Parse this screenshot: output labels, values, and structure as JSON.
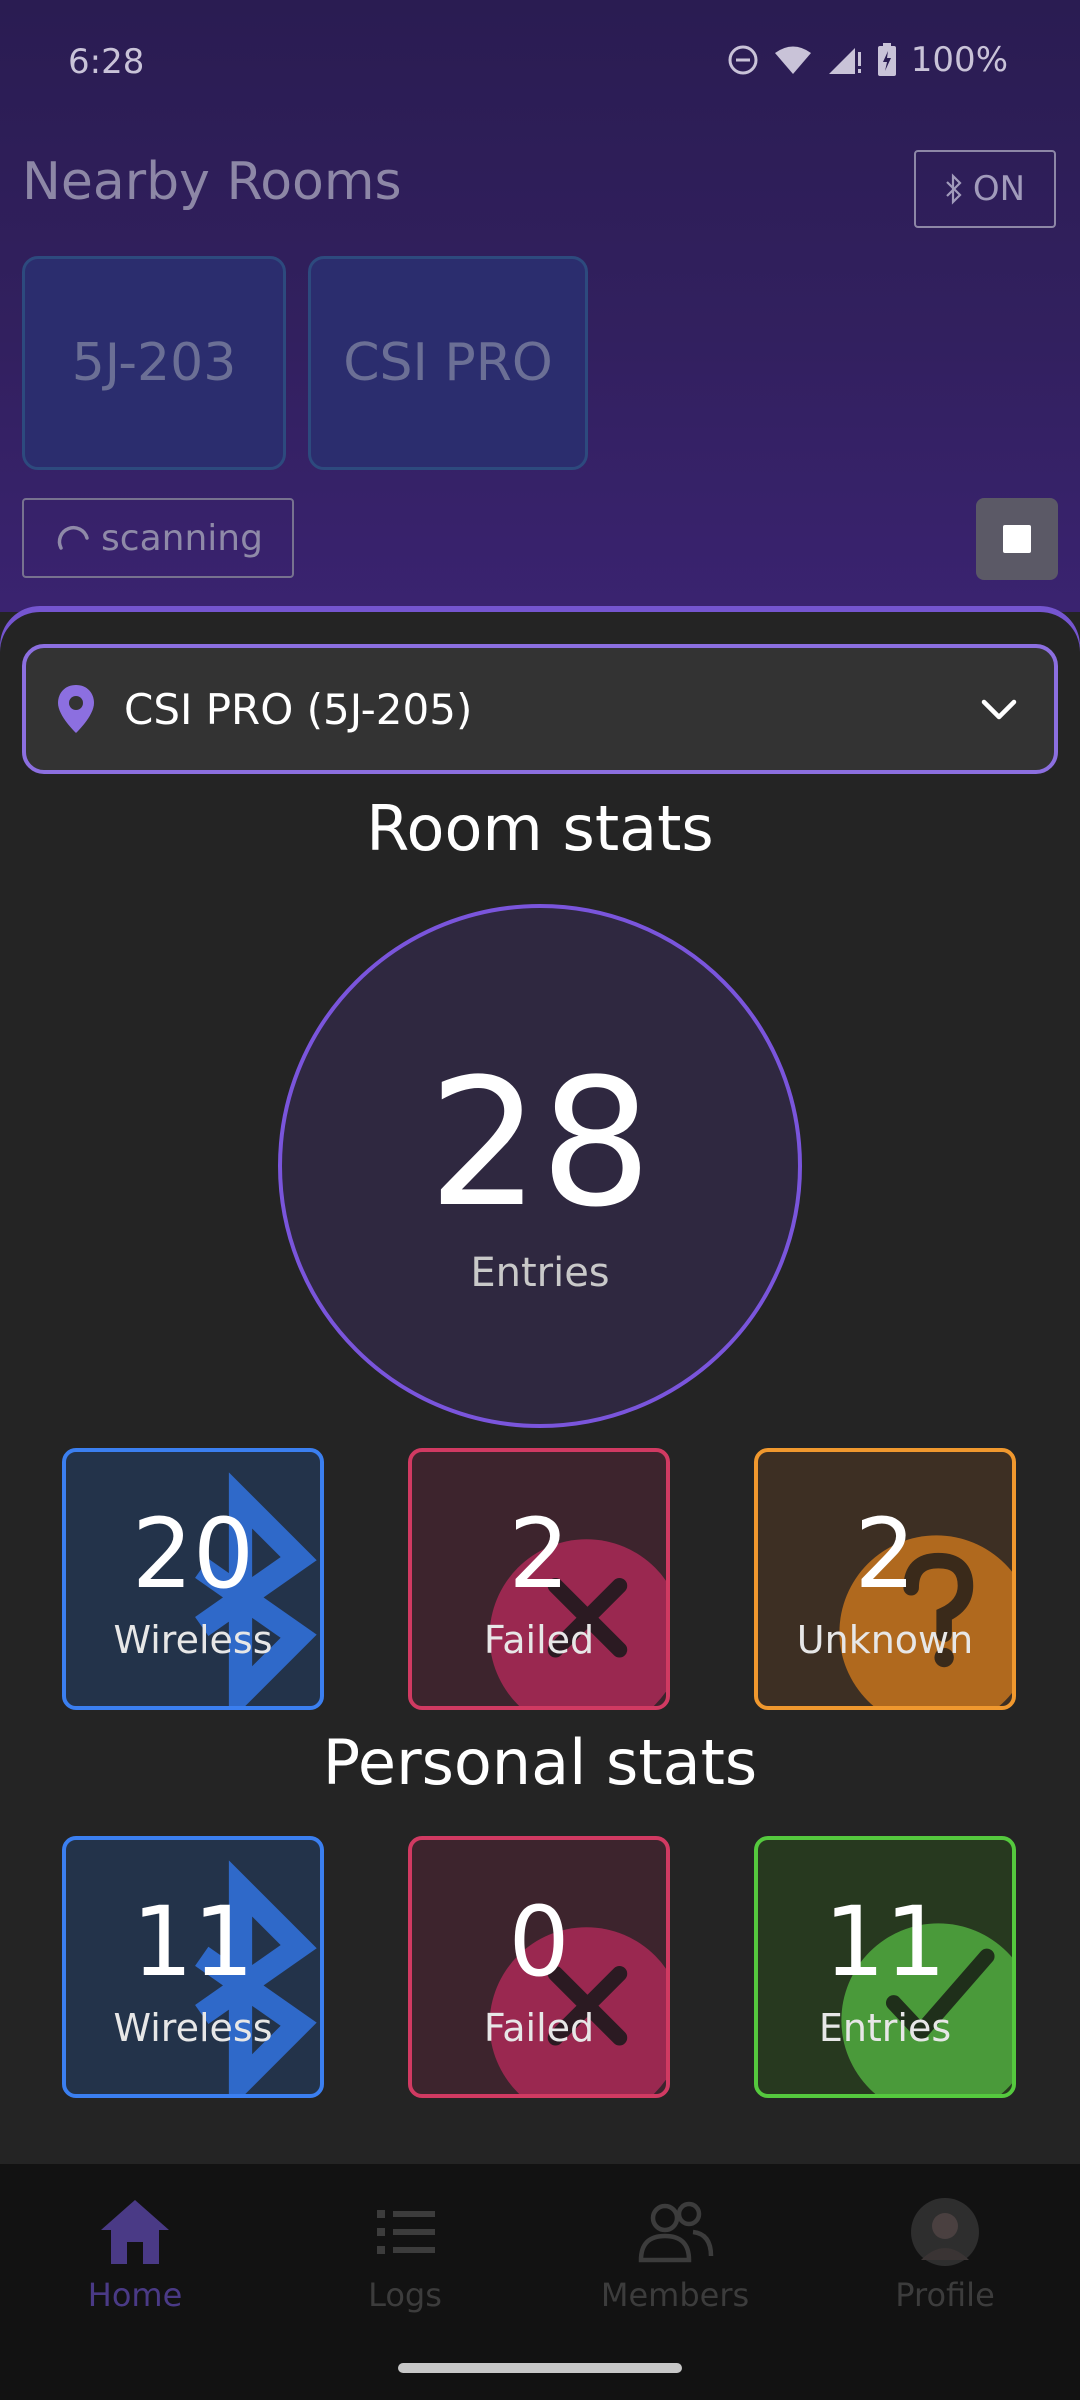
{
  "status_bar": {
    "time": "6:28",
    "battery": "100%"
  },
  "header": {
    "title": "Nearby Rooms",
    "bluetooth_state": "ON"
  },
  "nearby_rooms": [
    "5J-203",
    "CSI PRO"
  ],
  "scanning_label": "scanning",
  "room_selector": {
    "selected": "CSI PRO (5J-205)"
  },
  "room_stats": {
    "title": "Room stats",
    "entries_value": "28",
    "entries_label": "Entries",
    "tiles": [
      {
        "value": "20",
        "label": "Wireless"
      },
      {
        "value": "2",
        "label": "Failed"
      },
      {
        "value": "2",
        "label": "Unknown"
      }
    ]
  },
  "personal_stats": {
    "title": "Personal stats",
    "tiles": [
      {
        "value": "11",
        "label": "Wireless"
      },
      {
        "value": "0",
        "label": "Failed"
      },
      {
        "value": "11",
        "label": "Entries"
      }
    ]
  },
  "nav": {
    "home": "Home",
    "logs": "Logs",
    "members": "Members",
    "profile": "Profile"
  },
  "colors": {
    "accent": "#7a55dc",
    "wireless": "#3b7ff0",
    "failed": "#d13a62",
    "unknown": "#f0982e",
    "entries": "#55c93e"
  }
}
